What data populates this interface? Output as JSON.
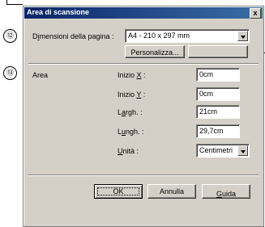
{
  "annotations": {
    "callout_12": "⑫",
    "callout_13": "⑬"
  },
  "dialog": {
    "title": "Area di scansione",
    "close_label": "x"
  },
  "page_size": {
    "label_pre": "D",
    "label_ul": "i",
    "label_post": "mensioni della pagina :",
    "value": "A4 - 210 x 297 mm",
    "customize_label": "Personalizza...",
    "second_button_label": ""
  },
  "area": {
    "label": "Area",
    "start_x": {
      "label_pre": "Inizio ",
      "label_ul": "X",
      "label_post": " :",
      "value": "0cm"
    },
    "start_y": {
      "label_pre": "Inizio ",
      "label_ul": "Y",
      "label_post": " :",
      "value": "0cm"
    },
    "width": {
      "label_pre": "L",
      "label_ul": "a",
      "label_post": "rgh. :",
      "value": "21cm"
    },
    "height": {
      "label_pre": "L",
      "label_ul": "u",
      "label_post": "ngh. :",
      "value": "29,7cm"
    },
    "unit": {
      "label_pre": "",
      "label_ul": "U",
      "label_post": "nità :",
      "value": "Centimetri"
    }
  },
  "buttons": {
    "ok": "OK",
    "cancel": "Annulla",
    "help_ul": "G",
    "help_rest": "uida"
  },
  "colors": {
    "titlebar": "#0a246a",
    "face": "#d4d0c8"
  }
}
